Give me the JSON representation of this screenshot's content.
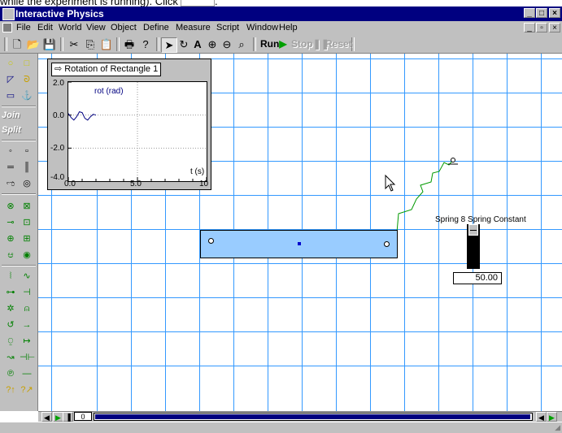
{
  "doc_caption": {
    "text_before": "while the experiment is running). Click",
    "text_after": "."
  },
  "window": {
    "title": "Interactive Physics"
  },
  "menubar": {
    "items": [
      {
        "id": "file",
        "label": "File"
      },
      {
        "id": "edit",
        "label": "Edit"
      },
      {
        "id": "world",
        "label": "World"
      },
      {
        "id": "view",
        "label": "View"
      },
      {
        "id": "object",
        "label": "Object"
      },
      {
        "id": "define",
        "label": "Define"
      },
      {
        "id": "measure",
        "label": "Measure"
      },
      {
        "id": "script",
        "label": "Script"
      },
      {
        "id": "window",
        "label": "Window"
      },
      {
        "id": "help",
        "label": "Help"
      }
    ]
  },
  "toolbar": {
    "run_label": "Run",
    "stop_label": "Stop",
    "reset_label": "Reset",
    "icons": [
      "new-icon",
      "open-icon",
      "save-icon",
      "cut-icon",
      "copy-icon",
      "paste-icon",
      "print-icon",
      "help-icon",
      "arrow-tool-icon",
      "rotate-tool-icon",
      "text-tool-icon",
      "zoom-in-icon",
      "zoom-out-icon",
      "zoom-fit-icon"
    ]
  },
  "palette": {
    "join_label": "Join",
    "split_label": "Split"
  },
  "graph": {
    "title": "Rotation of Rectangle 1",
    "series_label": "rot (rad)",
    "x_label": "t (s)",
    "y_ticks": [
      "2.0",
      "0.0",
      "-2.0",
      "-4.0"
    ],
    "x_ticks": [
      "0.0",
      "5.0",
      "10"
    ],
    "chart_data": {
      "type": "line",
      "xlim": [
        0,
        10
      ],
      "ylim": [
        -4,
        2
      ],
      "x": [
        0.0,
        0.2,
        0.4,
        0.6,
        0.8,
        1.0,
        1.2,
        1.4,
        1.6,
        1.8,
        2.0
      ],
      "y": [
        0.1,
        -0.15,
        -0.3,
        -0.1,
        0.2,
        0.15,
        -0.2,
        -0.3,
        -0.1,
        0.05,
        0.0
      ]
    }
  },
  "spring_control": {
    "label": "Spring 8 Spring Constant",
    "value": "50.00",
    "slider_position": 0.0
  },
  "playback": {
    "frame": "0"
  },
  "colors": {
    "titlebar": "#000080",
    "grid": "#3399ff",
    "rectangle": "#99ccff",
    "spring": "#009900",
    "series": "#000080"
  }
}
